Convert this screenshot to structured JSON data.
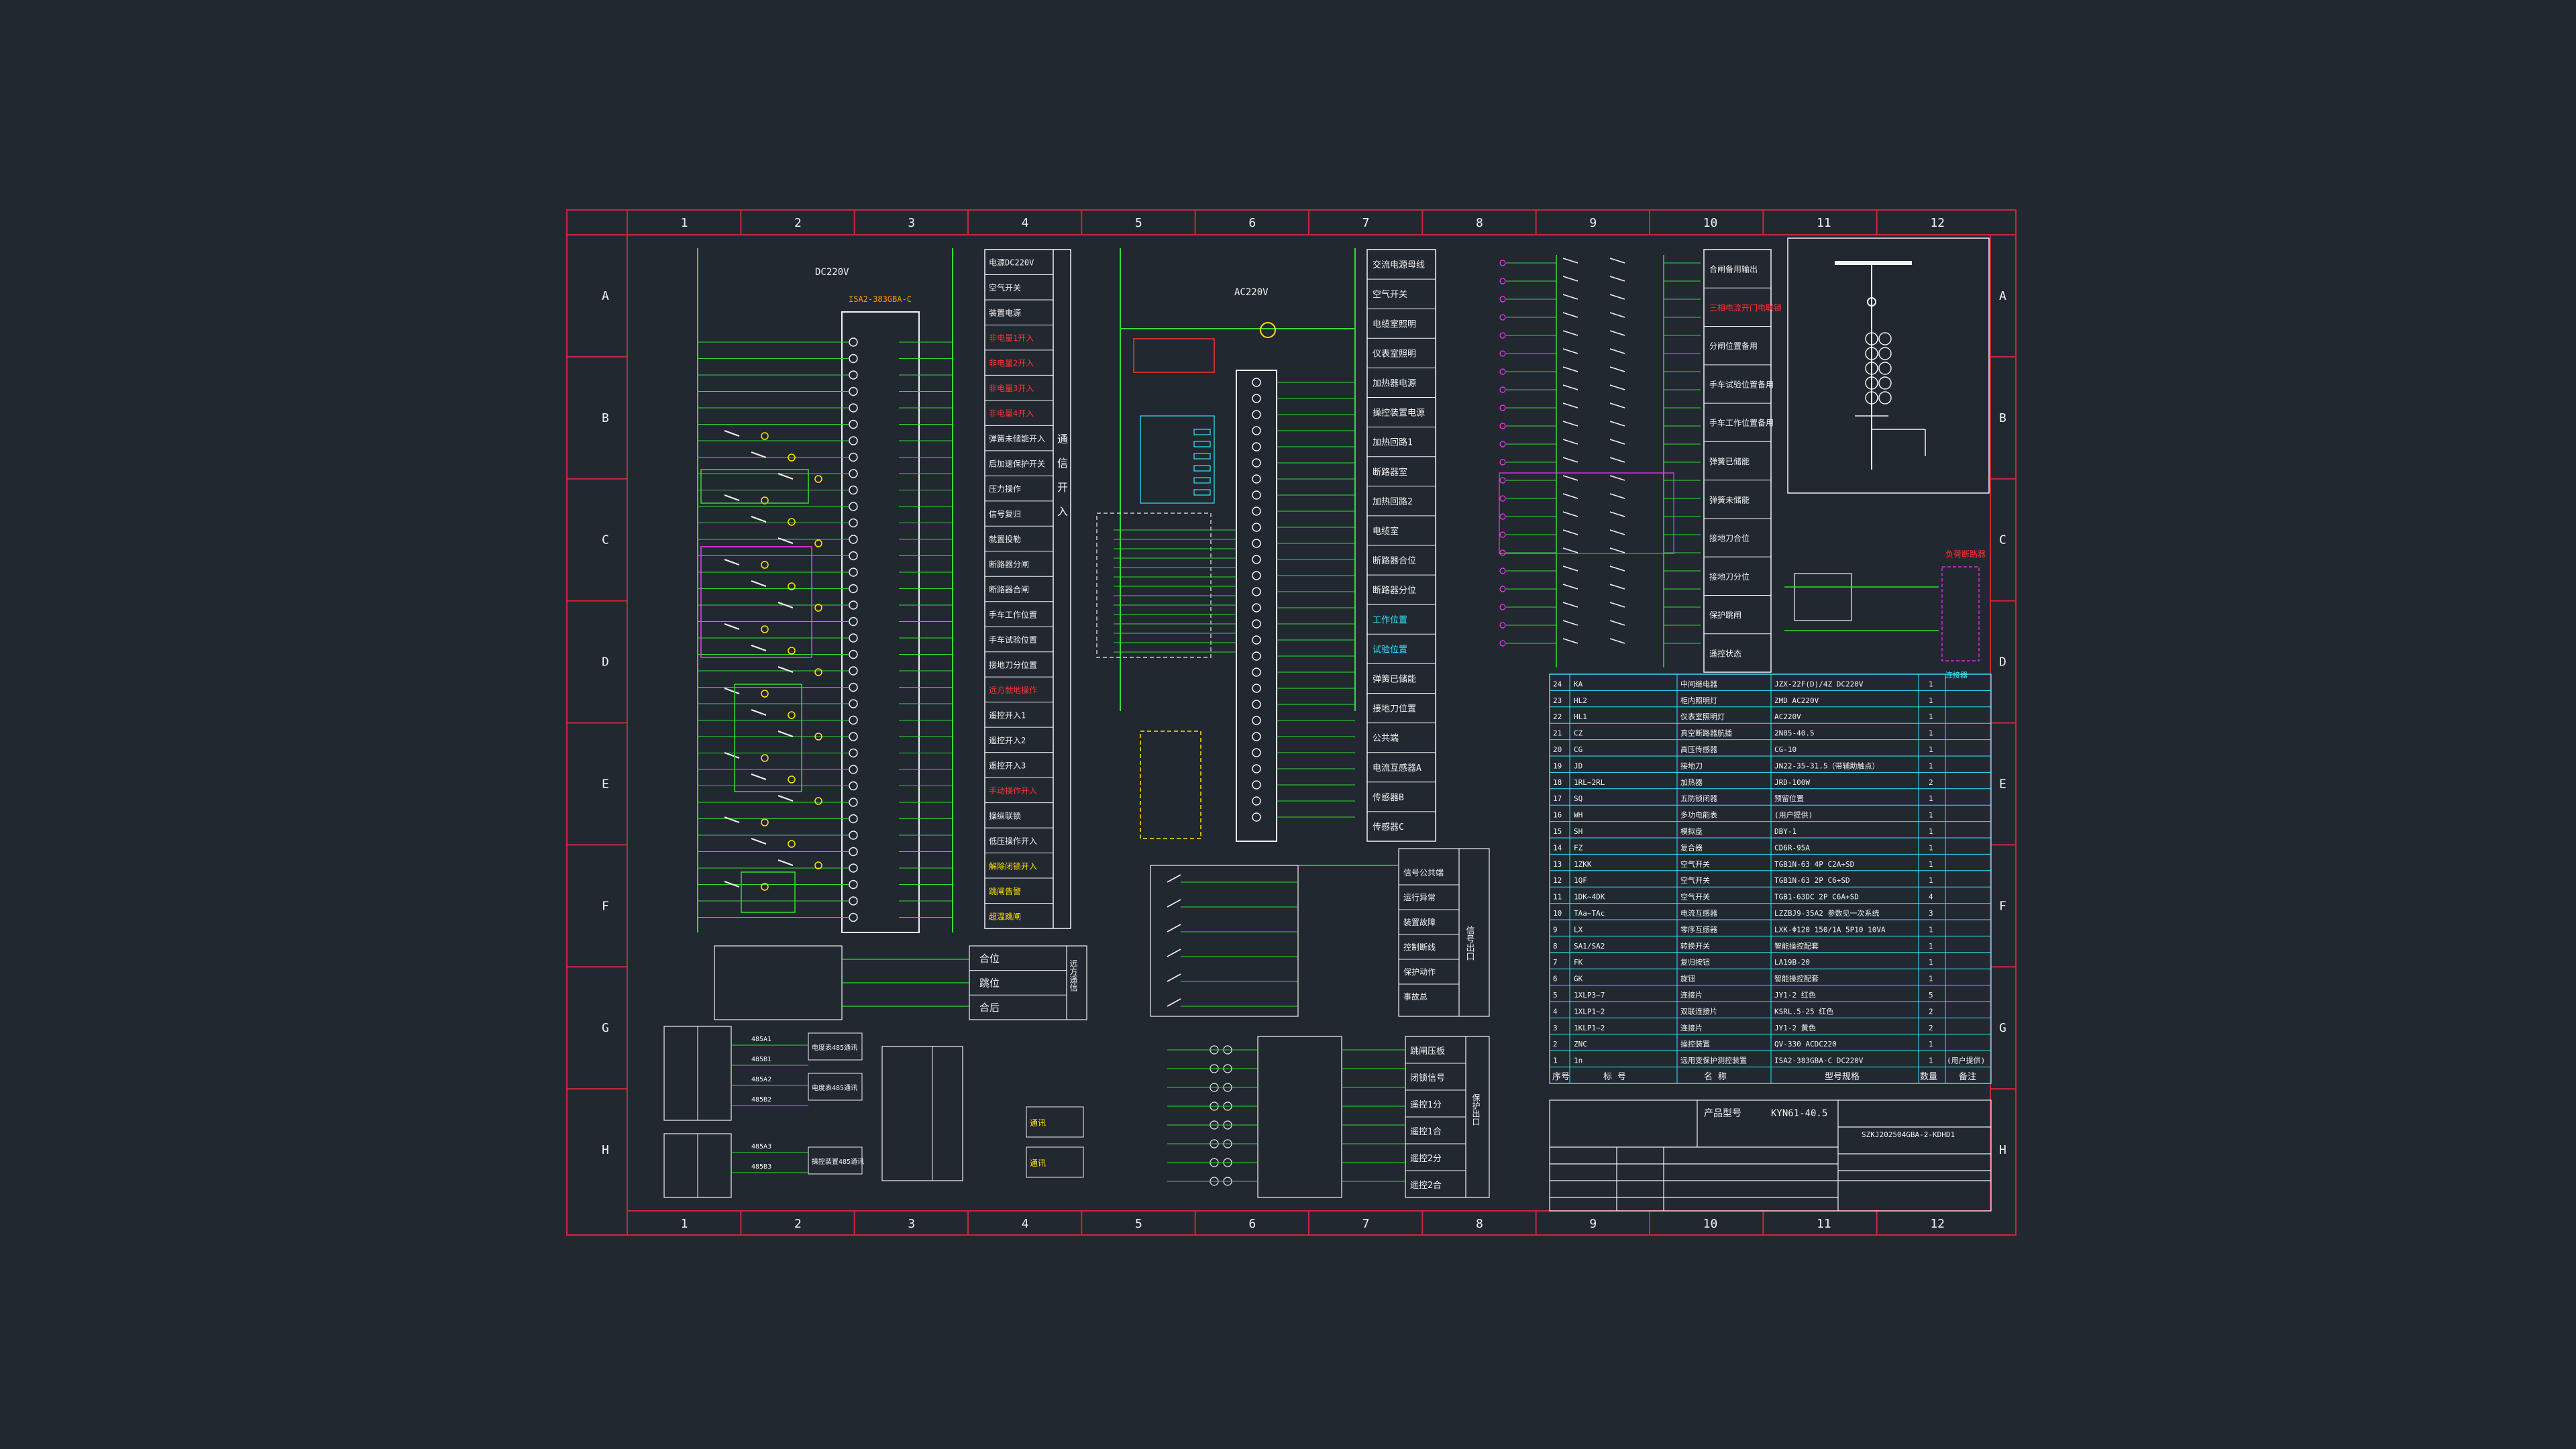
{
  "colors": {
    "bg": "#212830",
    "frame": "#c8283a",
    "white": "#f2f2f2",
    "yellow": "#ffe600",
    "green": "#33dd33",
    "magenta": "#ff33ff",
    "red": "#ff3333",
    "cyan": "#33e6ff",
    "orange": "#ff9900",
    "blue": "#4a70ff"
  },
  "cols": [
    "1",
    "2",
    "3",
    "4",
    "5",
    "6",
    "7",
    "8",
    "9",
    "10",
    "11",
    "12"
  ],
  "rows": [
    "A",
    "B",
    "C",
    "D",
    "E",
    "F",
    "G",
    "H"
  ],
  "supply_dc": "DC220V",
  "supply_ac": "AC220V",
  "device_dc": "ISA2-383GBA-C",
  "mid_labels": [
    "电源DC220V",
    "空气开关",
    "装置电源",
    "非电量1开入",
    "非电量2开入",
    "非电量3开入",
    "非电量4开入",
    "弹簧未储能开入",
    "后加速保护开关",
    "压力操作",
    "信号复归",
    "就置投勒",
    "断路器分闸",
    "断路器合闸",
    "手车工作位置",
    "手车试验位置",
    "接地刀分位置",
    "远方就地操作",
    "遥控开入1",
    "遥控开入2",
    "遥控开入3",
    "手动操作开入",
    "操纵联锁",
    "低压操作开入",
    "解除闭锁开入",
    "跳闸告警",
    "超温跳闸"
  ],
  "tongxin_vert": [
    "通",
    "信",
    "开",
    "入"
  ],
  "ac_labels": [
    "交流电源母线",
    "空气开关",
    "电缆室照明",
    "仪表室照明",
    "加热器电源",
    "操控装置电源",
    "加热回路1",
    "断路器室",
    "加热回路2",
    "电缆室",
    "断路器合位",
    "断路器分位",
    "工作位置",
    "试验位置",
    "弹簧已储能",
    "接地刀位置",
    "公共端",
    "电流互感器A",
    "传感器B",
    "传感器C"
  ],
  "right_labels": [
    "合闸备用输出",
    "三相电流开门电联锁",
    "分闸位置备用",
    "手车试验位置备用",
    "手车工作位置备用",
    "弹簧已储能",
    "弹簧未储能",
    "接地刀合位",
    "接地刀分位",
    "保护跳闸",
    "遥控状态"
  ],
  "bom_rows": [
    {
      "n": "24",
      "s": "KA",
      "name": "中间继电器",
      "model": "JZX-22F(D)/4Z DC220V",
      "q": "1"
    },
    {
      "n": "23",
      "s": "HL2",
      "name": "柜内照明灯",
      "model": "ZMD AC220V",
      "q": "1"
    },
    {
      "n": "22",
      "s": "HL1",
      "name": "仪表室照明灯",
      "model": "AC220V",
      "q": "1"
    },
    {
      "n": "21",
      "s": "CZ",
      "name": "真空断路器航插",
      "model": "2N85-40.5",
      "q": "1"
    },
    {
      "n": "20",
      "s": "CG",
      "name": "高压传感器",
      "model": "CG-10",
      "q": "1"
    },
    {
      "n": "19",
      "s": "JD",
      "name": "接地刀",
      "model": "JN22-35-31.5（带辅助触点）",
      "q": "1"
    },
    {
      "n": "18",
      "s": "1RL~2RL",
      "name": "加热器",
      "model": "JRD-100W",
      "q": "2"
    },
    {
      "n": "17",
      "s": "SQ",
      "name": "五防锁闭器",
      "model": "预留位置",
      "q": "1"
    },
    {
      "n": "16",
      "s": "WH",
      "name": "多功电能表",
      "model": "(用户提供)",
      "q": "1"
    },
    {
      "n": "15",
      "s": "SH",
      "name": "模拟盘",
      "model": "DBY-1",
      "q": "1"
    },
    {
      "n": "14",
      "s": "FZ",
      "name": "复合器",
      "model": "CD6R-95A",
      "q": "1"
    },
    {
      "n": "13",
      "s": "1ZKK",
      "name": "空气开关",
      "model": "TGB1N-63 4P C2A+SD",
      "q": "1"
    },
    {
      "n": "12",
      "s": "1QF",
      "name": "空气开关",
      "model": "TGB1N-63 2P C6+SD",
      "q": "1"
    },
    {
      "n": "11",
      "s": "1DK~4DK",
      "name": "空气开关",
      "model": "TGB1-63DC 2P C6A+SD",
      "q": "4"
    },
    {
      "n": "10",
      "s": "TAa~TAc",
      "name": "电流互感器",
      "model": "LZZBJ9-35A2 参数见一次系统",
      "q": "3"
    },
    {
      "n": "9",
      "s": "LX",
      "name": "零序互感器",
      "model": "LXK-Φ120 150/1A 5P10 10VA",
      "q": "1"
    },
    {
      "n": "8",
      "s": "SA1/SA2",
      "name": "转换开关",
      "model": "智能操控配套",
      "q": "1"
    },
    {
      "n": "7",
      "s": "FK",
      "name": "复归按钮",
      "model": "LA19B-20",
      "q": "1"
    },
    {
      "n": "6",
      "s": "GK",
      "name": "旋钮",
      "model": "智能操控配套",
      "q": "1"
    },
    {
      "n": "5",
      "s": "1XLP3~7",
      "name": "连接片",
      "model": "JY1-2 红色",
      "q": "5"
    },
    {
      "n": "4",
      "s": "1XLP1~2",
      "name": "双联连接片",
      "model": "KSRL.5-25 红色",
      "q": "2"
    },
    {
      "n": "3",
      "s": "1KLP1~2",
      "name": "连接片",
      "model": "JY1-2 黄色",
      "q": "2"
    },
    {
      "n": "2",
      "s": "ZNC",
      "name": "操控装置",
      "model": "QV-330 ACDC220",
      "q": "1"
    },
    {
      "n": "1",
      "s": "1n",
      "name": "远用变保护测控装置",
      "model": "ISA2-383GBA-C DC220V",
      "q": "1",
      "note": "(用户提供)"
    }
  ],
  "bom_header": [
    "序号",
    "标 号",
    "名 称",
    "型号规格",
    "数量",
    "备注"
  ],
  "product_label": "产品型号",
  "product_value": "KYN61-40.5",
  "drawing_code": "SZKJ202504GBA-2-KDHD1",
  "signal_out": [
    "信号公共端",
    "运行异常",
    "装置故障",
    "控制断线",
    "保护动作",
    "事故总"
  ],
  "signal_group": "信号出口",
  "remote_out": [
    "合位",
    "跳位",
    "合后"
  ],
  "remote_group": "远方遥信",
  "protect_out": [
    "跳闸压板",
    "闭锁信号",
    "遥控1分",
    "遥控1合",
    "遥控2分",
    "遥控2合"
  ],
  "protect_group": "保护出口",
  "comm_labels": [
    "电度表485通讯",
    "电度表485通讯",
    "操控装置485通讯"
  ],
  "comm_left": [
    "485A1",
    "485B1",
    "485A2",
    "485B2",
    "485A3",
    "485B3"
  ],
  "tongxun_label": "通讯",
  "mini_labels": [
    "负荷断路器",
    "连接器"
  ]
}
